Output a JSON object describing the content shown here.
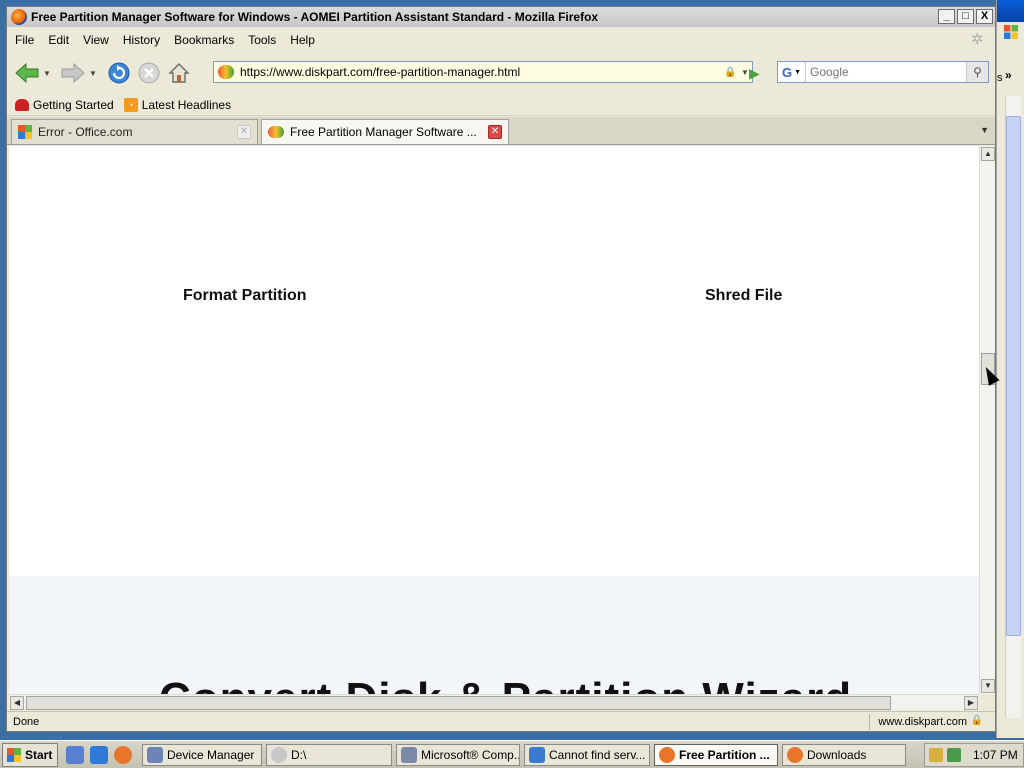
{
  "window": {
    "title": "Free Partition Manager Software for Windows - AOMEI Partition Assistant Standard - Mozilla Firefox",
    "minimize": "_",
    "maximize": "□",
    "close": "X"
  },
  "menu": [
    "File",
    "Edit",
    "View",
    "History",
    "Bookmarks",
    "Tools",
    "Help"
  ],
  "nav": {
    "url": "https://www.diskpart.com/free-partition-manager.html",
    "search_placeholder": "Google",
    "search_engine_icon": "google-icon"
  },
  "bookmarks": [
    {
      "label": "Getting Started",
      "icon": "firefox-bookmark-icon"
    },
    {
      "label": "Latest Headlines",
      "icon": "rss-icon"
    }
  ],
  "tabs": [
    {
      "label": "Error - Office.com",
      "active": false
    },
    {
      "label": "Free Partition Manager Software ...",
      "active": true
    }
  ],
  "content": {
    "label_format": "Format Partition",
    "label_shred": "Shred File",
    "partial_heading": "Convert Disk & Partition Wizard"
  },
  "status": {
    "text": "Done",
    "site": "www.diskpart.com"
  },
  "taskbar": {
    "start": "Start",
    "tasks": [
      {
        "label": "Device Manager",
        "active": false
      },
      {
        "label": "D:\\",
        "active": false
      },
      {
        "label": "Microsoft® Comp...",
        "active": false
      },
      {
        "label": "Cannot find serv...",
        "active": false
      },
      {
        "label": "Free Partition ...",
        "active": true
      },
      {
        "label": "Downloads",
        "active": false
      }
    ],
    "clock": "1:07 PM"
  },
  "bg_window": {
    "chevron": "»",
    "fragment": "s"
  },
  "colors": {
    "xp_blue": "#3a6ea5",
    "url_bg": "#fffde0",
    "tab_close_red": "#d84a4a"
  }
}
